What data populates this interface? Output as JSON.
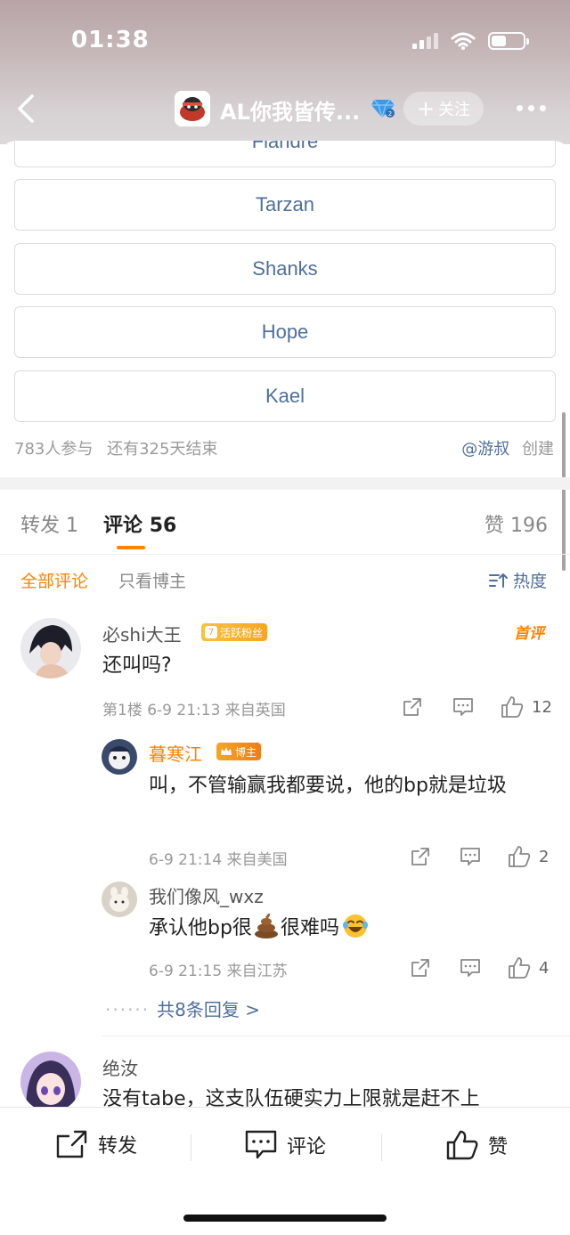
{
  "status_bar": {
    "time": "01:38"
  },
  "nav": {
    "title": "AL你我皆传...",
    "follow_label": "关注",
    "colors": {
      "follow_bg": "#ffffff59"
    }
  },
  "poll": {
    "partial_option": "Flandre",
    "options": [
      "Tarzan",
      "Shanks",
      "Hope",
      "Kael"
    ],
    "participants": "783人参与",
    "remaining": "还有325天结束",
    "creator": "@游叔",
    "creator_suffix": "创建"
  },
  "tabs": {
    "repost": {
      "label": "转发",
      "count": "1"
    },
    "comment": {
      "label": "评论",
      "count": "56"
    },
    "like": {
      "label": "赞",
      "count": "196"
    }
  },
  "filters": {
    "all": "全部评论",
    "blogger_only": "只看博主",
    "sort": "热度"
  },
  "comments": [
    {
      "user": "必shi大王",
      "badge_level": "7",
      "badge_text": "活跃粉丝",
      "tag": "首评",
      "text": "还叫吗?",
      "meta": "第1楼 6-9 21:13 来自英国",
      "likes": "12",
      "replies": [
        {
          "user": "暮寒江",
          "badge_text": "博主",
          "text": "叫，不管输赢我都要说，他的bp就是垃圾",
          "meta": "6-9 21:14 来自美国",
          "likes": "2"
        },
        {
          "user": "我们像风_wxz",
          "text_before": "承认他bp很",
          "text_after": "很难吗",
          "meta": "6-9 21:15 来自江苏",
          "likes": "4"
        }
      ],
      "more_replies": "共8条回复 >"
    },
    {
      "user": "绝汝",
      "text": "没有tabe，这支队伍硬实力上限就是赶不上"
    }
  ],
  "bottom_bar": {
    "repost": "转发",
    "comment": "评论",
    "like": "赞"
  },
  "colors": {
    "accent_orange": "#ff8200",
    "link_blue": "#4f6f9d",
    "text_gray": "#999999"
  }
}
